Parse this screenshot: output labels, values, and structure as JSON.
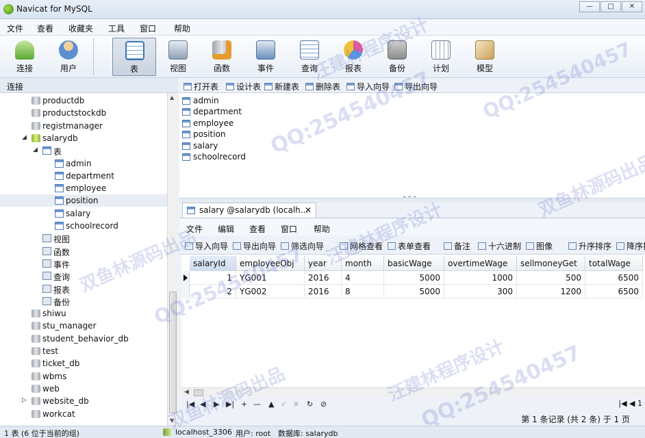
{
  "window": {
    "title": "Navicat for MySQL",
    "controls": {
      "minimize": "—",
      "maximize": "□",
      "close": "✕"
    }
  },
  "menu": [
    "文件",
    "查看",
    "收藏夹",
    "工具",
    "窗口",
    "帮助"
  ],
  "toolbar": [
    {
      "label": "连接",
      "icon": "connection-icon",
      "color": "#5aa832"
    },
    {
      "label": "用户",
      "icon": "user-icon",
      "color": "#e8b36a"
    },
    {
      "label": "表",
      "icon": "table-icon",
      "color": "#4f86c8",
      "active": true
    },
    {
      "label": "视图",
      "icon": "view-icon",
      "color": "#8ea0b8"
    },
    {
      "label": "函数",
      "icon": "function-icon",
      "color": "#d9a43c"
    },
    {
      "label": "事件",
      "icon": "event-icon",
      "color": "#6d8fbf"
    },
    {
      "label": "查询",
      "icon": "query-icon",
      "color": "#7f9fc7"
    },
    {
      "label": "报表",
      "icon": "report-icon",
      "color": "#c86fb0"
    },
    {
      "label": "备份",
      "icon": "backup-icon",
      "color": "#8c8c8c"
    },
    {
      "label": "计划",
      "icon": "schedule-icon",
      "color": "#9aa7b7"
    },
    {
      "label": "模型",
      "icon": "model-icon",
      "color": "#c9a15a"
    }
  ],
  "left_panel": {
    "header": "连接",
    "tree": [
      {
        "label": "productdb",
        "type": "db",
        "level": 0
      },
      {
        "label": "productstockdb",
        "type": "db",
        "level": 0
      },
      {
        "label": "registmanager",
        "type": "db",
        "level": 0
      },
      {
        "label": "salarydb",
        "type": "db-open",
        "level": 0,
        "expanded": true
      },
      {
        "label": "表",
        "type": "folder-table",
        "level": 1,
        "expanded": true
      },
      {
        "label": "admin",
        "type": "table",
        "level": 2
      },
      {
        "label": "department",
        "type": "table",
        "level": 2
      },
      {
        "label": "employee",
        "type": "table",
        "level": 2
      },
      {
        "label": "position",
        "type": "table",
        "level": 2,
        "selected": true
      },
      {
        "label": "salary",
        "type": "table",
        "level": 2
      },
      {
        "label": "schoolrecord",
        "type": "table",
        "level": 2
      },
      {
        "label": "视图",
        "type": "view",
        "level": 1
      },
      {
        "label": "函数",
        "type": "function",
        "level": 1
      },
      {
        "label": "事件",
        "type": "event",
        "level": 1
      },
      {
        "label": "查询",
        "type": "query",
        "level": 1
      },
      {
        "label": "报表",
        "type": "report",
        "level": 1
      },
      {
        "label": "备份",
        "type": "backup",
        "level": 1
      },
      {
        "label": "shiwu",
        "type": "db",
        "level": 0
      },
      {
        "label": "stu_manager",
        "type": "db",
        "level": 0
      },
      {
        "label": "student_behavior_db",
        "type": "db",
        "level": 0
      },
      {
        "label": "test",
        "type": "db",
        "level": 0
      },
      {
        "label": "ticket_db",
        "type": "db",
        "level": 0
      },
      {
        "label": "wbms",
        "type": "db",
        "level": 0
      },
      {
        "label": "web",
        "type": "db",
        "level": 0
      },
      {
        "label": "website_db",
        "type": "db",
        "level": 0,
        "collapsed_arrow": true
      },
      {
        "label": "workcat",
        "type": "db",
        "level": 0
      }
    ]
  },
  "object_toolbar": [
    "打开表",
    "设计表",
    "新建表",
    "删除表",
    "导入向导",
    "导出向导"
  ],
  "object_list": [
    "admin",
    "department",
    "employee",
    "position",
    "salary",
    "schoolrecord"
  ],
  "doc_tab": {
    "label": "salary @salarydb (localh...",
    "close": "✕"
  },
  "inner_menu": [
    "文件",
    "编辑",
    "查看",
    "窗口",
    "帮助"
  ],
  "inner_toolbar": [
    "导入向导",
    "导出向导",
    "筛选向导",
    "网格查看",
    "表单查看",
    "备注",
    "十六进制",
    "图像",
    "升序排序",
    "降序排"
  ],
  "grid": {
    "columns": [
      "salaryId",
      "employeeObj",
      "year",
      "month",
      "basicWage",
      "overtimeWage",
      "sellmoneyGet",
      "totalWage"
    ],
    "rows": [
      [
        "1",
        "YG001",
        "2016",
        "4",
        "5000",
        "1000",
        "500",
        "6500"
      ],
      [
        "2",
        "YG002",
        "2016",
        "8",
        "5000",
        "300",
        "1200",
        "6500"
      ]
    ]
  },
  "nav_buttons": [
    "|◀",
    "◀",
    "▶",
    "▶|",
    "+",
    "—",
    "▲",
    "✓",
    "✕",
    "↻",
    "⊘"
  ],
  "record_status": "第 1 条记录 (共 2 条) 于 1 页",
  "page_indicator": "1",
  "statusbar": {
    "left": "1 表 (6 位于当前的组)",
    "connection": "localhost_3306",
    "user": "用户: root",
    "database": "数据库: salarydb"
  },
  "watermarks": [
    "QQ:254540457",
    "汪建林程序设计",
    "双鱼林源码出品"
  ]
}
